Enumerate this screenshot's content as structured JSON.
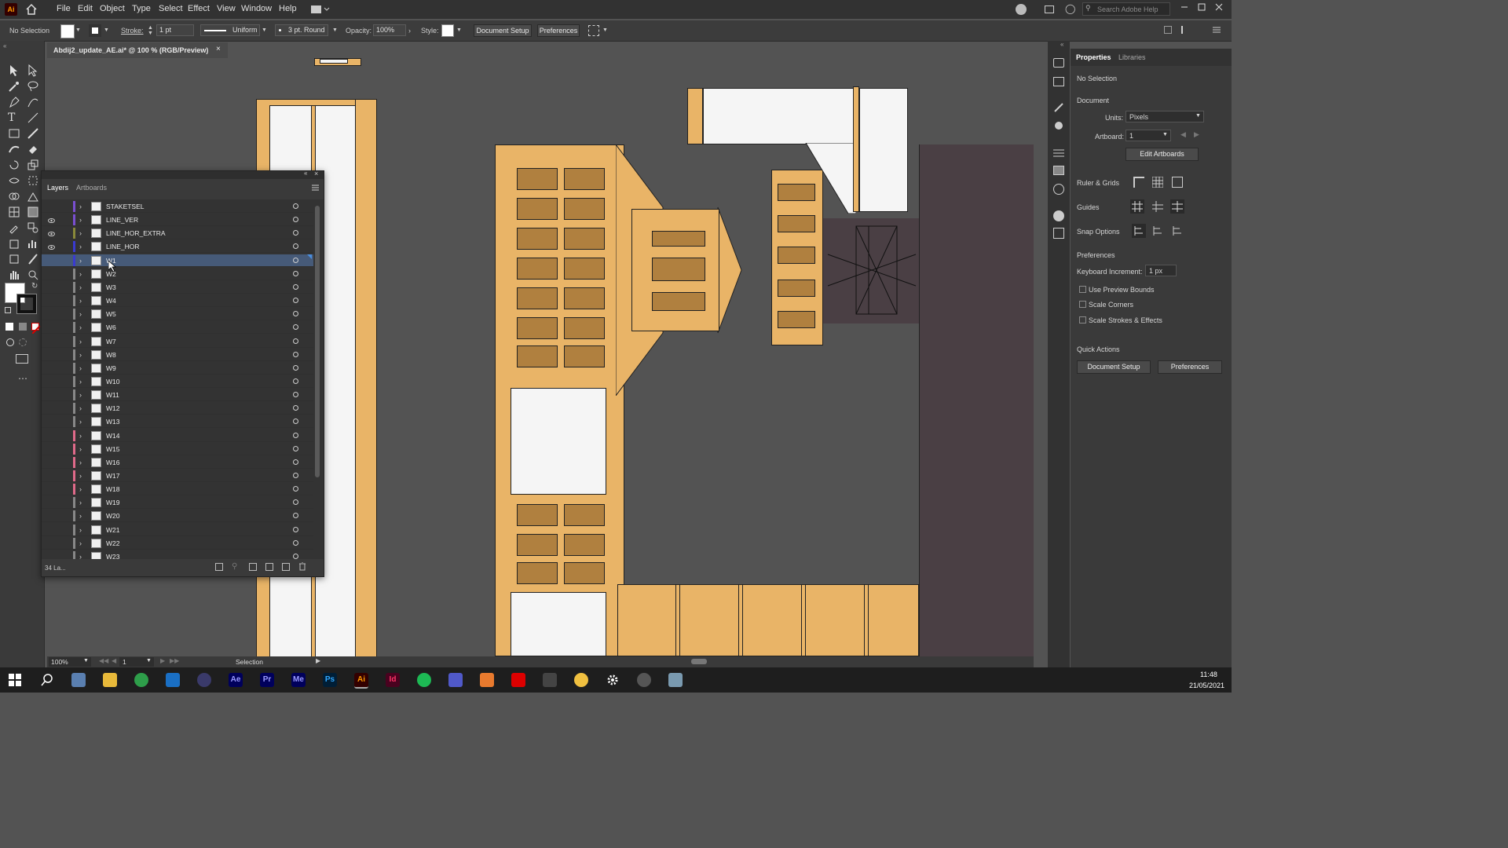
{
  "menubar": {
    "app_icon": "Ai",
    "items": [
      "File",
      "Edit",
      "Object",
      "Type",
      "Select",
      "Effect",
      "View",
      "Window",
      "Help"
    ],
    "search_placeholder": "Search Adobe Help"
  },
  "controlbar": {
    "selection": "No Selection",
    "stroke_label": "Stroke:",
    "stroke_value": "1 pt",
    "profile": "Uniform",
    "brush": "3 pt. Round",
    "opacity_label": "Opacity:",
    "opacity_value": "100%",
    "style_label": "Style:",
    "doc_setup": "Document Setup",
    "preferences": "Preferences"
  },
  "document": {
    "tab_title": "Abdij2_update_AE.ai* @ 100 % (RGB/Preview)"
  },
  "layers_panel": {
    "tabs": [
      "Layers",
      "Artboards"
    ],
    "rows": [
      {
        "name": "STAKETSEL",
        "visible": false,
        "color": "#7a4fd1"
      },
      {
        "name": "LINE_VER",
        "visible": true,
        "color": "#7a4fd1"
      },
      {
        "name": "LINE_HOR_EXTRA",
        "visible": true,
        "color": "#8a8a3a"
      },
      {
        "name": "LINE_HOR",
        "visible": true,
        "color": "#3a3ad1"
      },
      {
        "name": "W1",
        "visible": false,
        "color": "#3a3ad1",
        "selected": true
      },
      {
        "name": "W2",
        "visible": false,
        "color": "#888888"
      },
      {
        "name": "W3",
        "visible": false,
        "color": "#888888"
      },
      {
        "name": "W4",
        "visible": false,
        "color": "#888888"
      },
      {
        "name": "W5",
        "visible": false,
        "color": "#888888"
      },
      {
        "name": "W6",
        "visible": false,
        "color": "#888888"
      },
      {
        "name": "W7",
        "visible": false,
        "color": "#888888"
      },
      {
        "name": "W8",
        "visible": false,
        "color": "#888888"
      },
      {
        "name": "W9",
        "visible": false,
        "color": "#888888"
      },
      {
        "name": "W10",
        "visible": false,
        "color": "#888888"
      },
      {
        "name": "W11",
        "visible": false,
        "color": "#888888"
      },
      {
        "name": "W12",
        "visible": false,
        "color": "#888888"
      },
      {
        "name": "W13",
        "visible": false,
        "color": "#888888"
      },
      {
        "name": "W14",
        "visible": false,
        "color": "#e06a8a"
      },
      {
        "name": "W15",
        "visible": false,
        "color": "#e06a8a"
      },
      {
        "name": "W16",
        "visible": false,
        "color": "#e06a8a"
      },
      {
        "name": "W17",
        "visible": false,
        "color": "#e06a8a"
      },
      {
        "name": "W18",
        "visible": false,
        "color": "#e06a8a"
      },
      {
        "name": "W19",
        "visible": false,
        "color": "#888888"
      },
      {
        "name": "W20",
        "visible": false,
        "color": "#888888"
      },
      {
        "name": "W21",
        "visible": false,
        "color": "#888888"
      },
      {
        "name": "W22",
        "visible": false,
        "color": "#888888"
      },
      {
        "name": "W23",
        "visible": false,
        "color": "#888888"
      }
    ],
    "count_label": "34 La..."
  },
  "properties_panel": {
    "tabs": [
      "Properties",
      "Libraries"
    ],
    "selection": "No Selection",
    "document_label": "Document",
    "units_label": "Units:",
    "units_value": "Pixels",
    "artboard_label": "Artboard:",
    "artboard_value": "1",
    "edit_artboards": "Edit Artboards",
    "ruler_grids": "Ruler & Grids",
    "guides": "Guides",
    "snap_options": "Snap Options",
    "preferences_label": "Preferences",
    "keyboard_increment_label": "Keyboard Increment:",
    "keyboard_increment_value": "1 px",
    "checkbox_preview_bounds": "Use Preview Bounds",
    "checkbox_scale_corners": "Scale Corners",
    "checkbox_scale_strokes": "Scale Strokes & Effects",
    "quick_actions": "Quick Actions",
    "btn_doc_setup": "Document Setup",
    "btn_preferences": "Preferences"
  },
  "statusbar": {
    "zoom": "100%",
    "artboard": "1",
    "tool": "Selection"
  },
  "taskbar": {
    "time": "11:48",
    "date": "21/05/2021",
    "apps": [
      "Ae",
      "Pr",
      "Me",
      "Ps",
      "Ai",
      "Id"
    ]
  }
}
